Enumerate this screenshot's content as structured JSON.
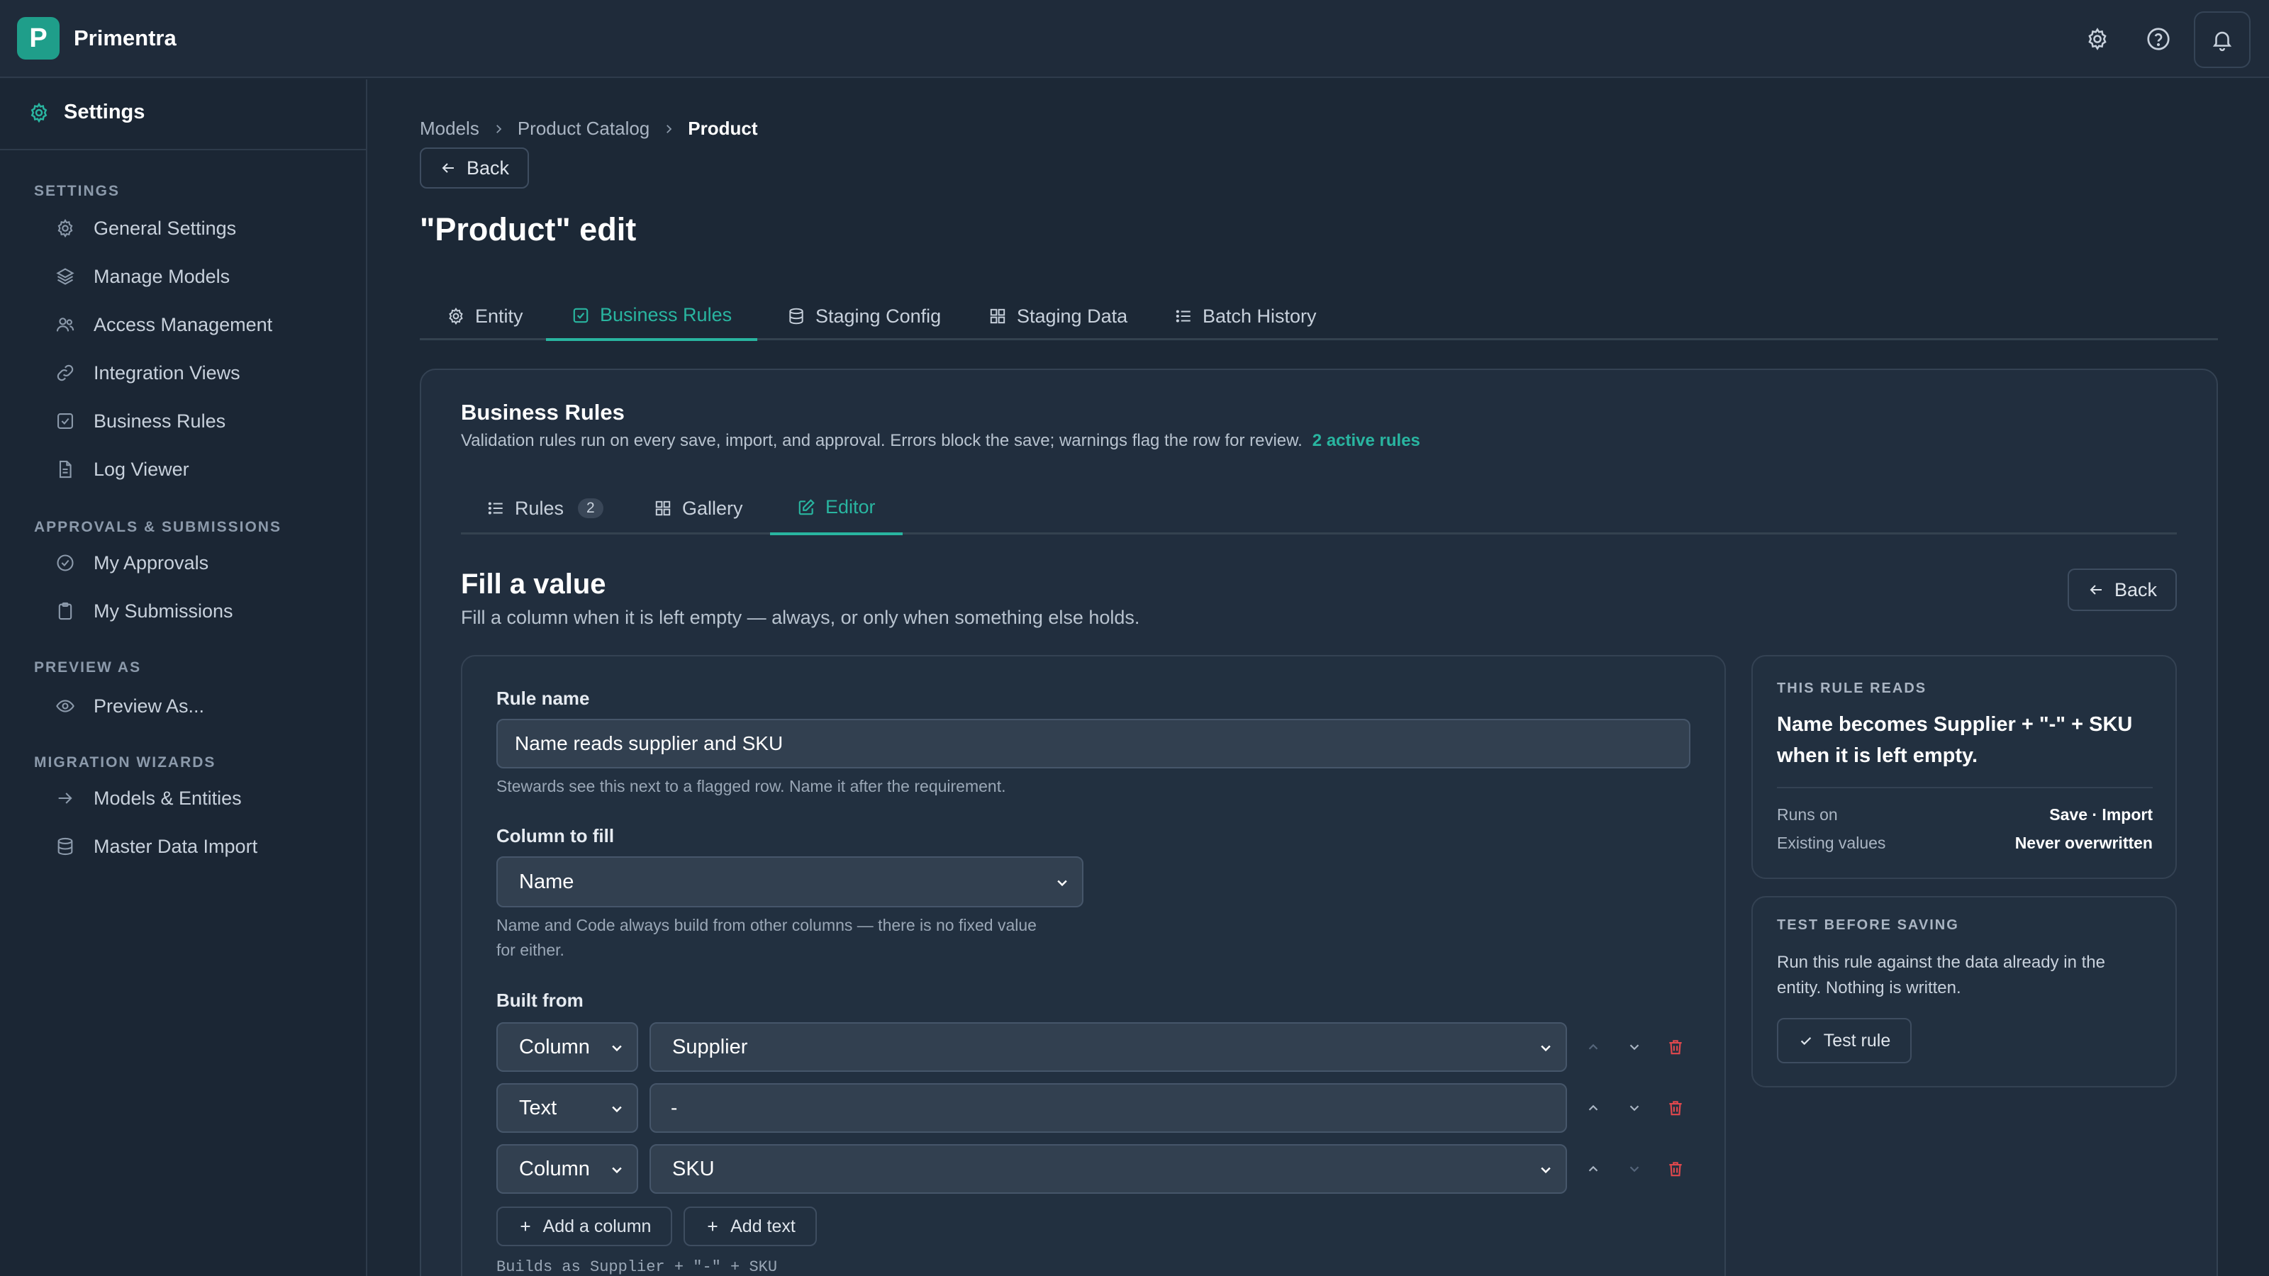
{
  "app": {
    "name": "Primentra",
    "logo_letter": "P"
  },
  "sidebar": {
    "title": "Settings",
    "sections": [
      {
        "label": "SETTINGS",
        "items": [
          "General Settings",
          "Manage Models",
          "Access Management",
          "Integration Views",
          "Business Rules",
          "Log Viewer"
        ]
      },
      {
        "label": "APPROVALS & SUBMISSIONS",
        "items": [
          "My Approvals",
          "My Submissions"
        ]
      },
      {
        "label": "PREVIEW AS",
        "items": [
          "Preview As..."
        ]
      },
      {
        "label": "MIGRATION WIZARDS",
        "items": [
          "Models & Entities",
          "Master Data Import"
        ]
      }
    ]
  },
  "breadcrumb": [
    "Models",
    "Product Catalog",
    "Product"
  ],
  "back_label": "Back",
  "page_title": "\"Product\" edit",
  "tabs": [
    "Entity",
    "Business Rules",
    "Staging Config",
    "Staging Data",
    "Batch History"
  ],
  "active_tab": "Business Rules",
  "business_rules": {
    "title": "Business Rules",
    "description": "Validation rules run on every save, import, and approval. Errors block the save; warnings flag the row for review.",
    "active_count": "2 active rules",
    "subtabs": [
      {
        "label": "Rules",
        "badge": "2"
      },
      {
        "label": "Gallery"
      },
      {
        "label": "Editor"
      }
    ],
    "active_subtab": "Editor"
  },
  "editor": {
    "title": "Fill a value",
    "description": "Fill a column when it is left empty — always, or only when something else holds.",
    "back_label": "Back",
    "rule_name_label": "Rule name",
    "rule_name_value": "Name reads supplier and SKU",
    "rule_name_hint": "Stewards see this next to a flagged row. Name it after the requirement.",
    "column_label": "Column to fill",
    "column_value": "Name",
    "column_hint_1": "Name and Code always build from other columns — there is no fixed value",
    "column_hint_2": "for either.",
    "built_from_label": "Built from",
    "parts": [
      {
        "type": "Column",
        "value": "Supplier"
      },
      {
        "type": "Text",
        "value": "-"
      },
      {
        "type": "Column",
        "value": "SKU"
      }
    ],
    "add_column_label": "Add a column",
    "add_text_label": "Add text",
    "builds_as": "Builds as Supplier + \"-\" + SKU"
  },
  "rule_reads": {
    "label": "THIS RULE READS",
    "sentence_1": "Name becomes Supplier + \"-\" + SKU",
    "sentence_2": "when it is left empty.",
    "runs_on_label": "Runs on",
    "runs_on_value": "Save · Import",
    "existing_label": "Existing values",
    "existing_value": "Never overwritten"
  },
  "test_panel": {
    "label": "TEST BEFORE SAVING",
    "text_1": "Run this rule against the data already in the",
    "text_2": "entity. Nothing is written.",
    "button": "Test rule"
  },
  "colors": {
    "accent": "#29b5a0",
    "danger": "#e0484d",
    "bg": "#1c2836"
  }
}
